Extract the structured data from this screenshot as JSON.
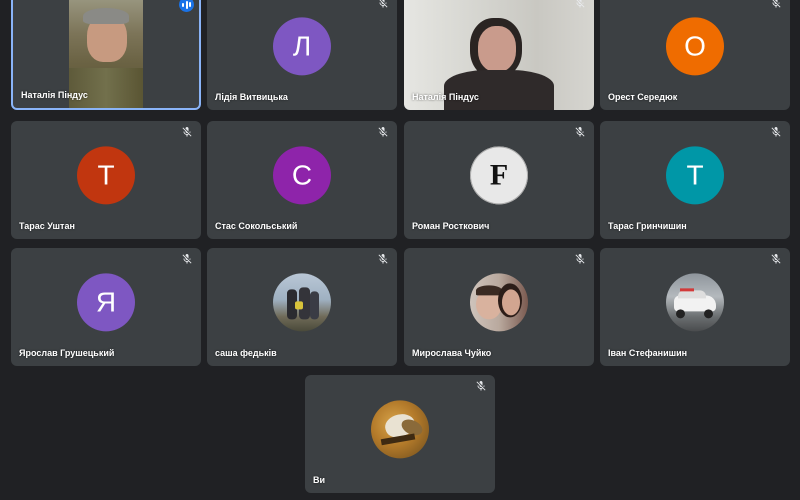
{
  "colors": {
    "background": "#202124",
    "tile": "#3c4043",
    "active_border": "#8ab4f8",
    "speaking_badge": "#1a73e8"
  },
  "participants": [
    {
      "name": "Наталія Піндус",
      "type": "video",
      "icon": "speaking-icon"
    },
    {
      "name": "Лідія Витвицька",
      "type": "letter",
      "letter": "Л",
      "color": "#7e57c2",
      "icon": "mic-off-icon"
    },
    {
      "name": "Наталія Піндус",
      "type": "video",
      "icon": "mic-off-icon"
    },
    {
      "name": "Орест Середюк",
      "type": "letter",
      "letter": "О",
      "color": "#ef6c00",
      "icon": "mic-off-icon"
    },
    {
      "name": "Тарас Уштан",
      "type": "letter",
      "letter": "Т",
      "color": "#c1360f",
      "icon": "mic-off-icon"
    },
    {
      "name": "Стас Сокольський",
      "type": "letter",
      "letter": "С",
      "color": "#8e24aa",
      "icon": "mic-off-icon"
    },
    {
      "name": "Роман Росткович",
      "type": "letter",
      "letter": "F",
      "color": "#e8e8e8",
      "icon": "mic-off-icon"
    },
    {
      "name": "Тарас Гринчишин",
      "type": "letter",
      "letter": "Т",
      "color": "#0097a7",
      "icon": "mic-off-icon"
    },
    {
      "name": "Ярослав Грушецький",
      "type": "letter",
      "letter": "Я",
      "color": "#7e57c2",
      "icon": "mic-off-icon"
    },
    {
      "name": "саша федьків",
      "type": "photo",
      "icon": "mic-off-icon"
    },
    {
      "name": "Мирослава Чуйко",
      "type": "photo",
      "icon": "mic-off-icon"
    },
    {
      "name": "Іван Стефанишин",
      "type": "photo",
      "icon": "mic-off-icon"
    },
    {
      "name": "Ви",
      "type": "photo",
      "icon": "mic-off-icon"
    }
  ]
}
